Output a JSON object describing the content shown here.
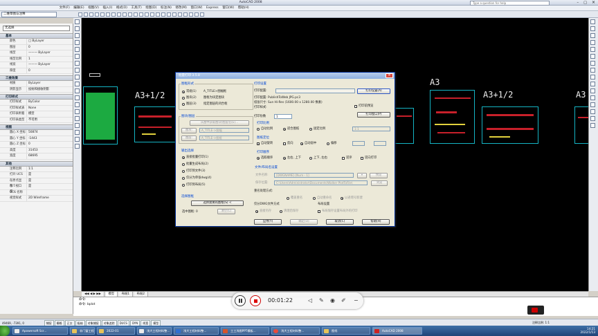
{
  "window": {
    "title": "AutoCAD 2008"
  },
  "help_placeholder": "Type a question for help",
  "menu": [
    "文件(F)",
    "编辑(E)",
    "视图(V)",
    "插入(I)",
    "格式(O)",
    "工具(T)",
    "绘图(D)",
    "标注(N)",
    "修改(M)",
    "窗口(W)",
    "Express",
    "窗口(W)",
    "帮助(H)"
  ],
  "workspace": "二维草图与注释",
  "properties": {
    "combo": "无选择",
    "sections": [
      {
        "title": "基本",
        "rows": [
          [
            "颜色",
            "□ ByLayer"
          ],
          [
            "图层",
            "0"
          ],
          [
            "线型",
            "——— ByLayer"
          ],
          [
            "线型比例",
            "1"
          ],
          [
            "线宽",
            "——— ByLayer"
          ],
          [
            "厚度",
            "0"
          ]
        ]
      },
      {
        "title": "三维效果",
        "rows": [
          [
            "材质",
            "ByLayer"
          ],
          [
            "阴影显示",
            "投射和接收阴影"
          ]
        ]
      },
      {
        "title": "打印样式",
        "rows": [
          [
            "打印样式",
            "ByColor"
          ],
          [
            "打印样式表",
            "None"
          ],
          [
            "打印表附着",
            "模型"
          ],
          [
            "打印表类型",
            "不可用"
          ]
        ]
      },
      {
        "title": "视图",
        "rows": [
          [
            "圆心 X 坐标",
            "50874"
          ],
          [
            "圆心 Y 坐标",
            "-1443"
          ],
          [
            "圆心 Z 坐标",
            "0"
          ],
          [
            "高度",
            "31453"
          ],
          [
            "宽度",
            "68695"
          ]
        ]
      },
      {
        "title": "其他",
        "rows": [
          [
            "注释比例",
            "1:1"
          ],
          [
            "打开 UCS ...",
            "是"
          ],
          [
            "在原点显示...",
            "是"
          ],
          [
            "每个视口都...",
            "是"
          ],
          [
            "UCS 名称",
            ""
          ],
          [
            "视觉样式",
            "2D Wireframe"
          ]
        ]
      }
    ]
  },
  "drawing_labels": [
    "A3+1/2",
    "A3",
    "A3+1/2",
    "A3"
  ],
  "layout_tabs": [
    "模型",
    "布局1",
    "布局2"
  ],
  "command_lines": [
    "命令:",
    "命令: bplot"
  ],
  "player": {
    "time": "00:01:22"
  },
  "status": {
    "coords": "49469, -7391, 0",
    "toggles": [
      "捕捉",
      "栅格",
      "正交",
      "极轴",
      "对象捕捉",
      "对象追踪",
      "DUCS",
      "DYN",
      "线宽",
      "模型"
    ],
    "scale": "注释比例: 1:1"
  },
  "taskbar": {
    "items": [
      "Apowersoft Scr...",
      "非门窗工程",
      "2022-01",
      "浅大工程材料整...",
      "工工浅图PPT模板...",
      "浅大工程材料整...",
      "图纸",
      "AutoCAD 2008"
    ],
    "clock_time": "14:21",
    "clock_date": "2022/1/13"
  },
  "dialog": {
    "title": "批量打印 3.5.8",
    "left": {
      "figure_mode_title": "图框形式",
      "figure_modes": [
        "常规(1)",
        "图块(2)",
        "图层(3)"
      ],
      "figure_mode_descs": [
        "A_TITLE>图幅框",
        "图框为块定图块",
        "指定图层的闭合框"
      ],
      "figure_name_title": "图块/图层",
      "figure_name_btn": "从图中获取图块/图层名(E)...",
      "block_label": "图块:",
      "block_value": "A_TITLE->图幅",
      "layer_label": "图层:",
      "layer_value": "A_TITLE->图框",
      "output_title": "输出选择",
      "outputs": [
        "直接批量打印(1)",
        "批量生成布局(2)",
        "打印到文件(3)",
        "仅分为单张dwg(4)",
        "打印到布局(5)"
      ],
      "select_title": "选择图框",
      "select_btn": "选择需要的图框(S) <",
      "selected_label": "选中图框: 0",
      "clear_btn": "清空(C)"
    },
    "right": {
      "print_title": "打印设置",
      "printer_label": "打印配置:",
      "printer_value": "",
      "printer_btn": "打印设置(A)",
      "info_lines": [
        "打印配置: PublishToWeb JPG.pc3",
        "纸张尺寸: Sun Hi-Res (1600.00 x 1280.00 像素)",
        "打印样式:"
      ],
      "prefix_label": "打印份数",
      "copies_value": "1",
      "fit_title": "打印比例",
      "scale_opts": [
        "自动比例",
        "适合图纸",
        "固定比例"
      ],
      "scale_value": "1:1",
      "rotate_chk": "打印前预览",
      "copy_btn": "打印窗口(P)",
      "dir_title": "图纸定位",
      "dir_opts": [
        "自动旋转",
        "反向",
        "自动居中",
        "偏移"
      ],
      "order_title": "打印顺序",
      "order_opts": [
        "选取顺序",
        "左右, 上下",
        "上下, 左右",
        "逆序",
        "逆向打印"
      ],
      "file_title": "文件/布局名设置",
      "file_name_label": "文件名称:",
      "file_name_value": "[DWGNAME]-[Num - 1]",
      "file_name_btn": "预览",
      "path_label": "保存位置:",
      "path_value": "C:\\Users\\Administrator\\Documents\\Walker PlotToFile\\",
      "path_btn": "浏览",
      "dup_title": "重名处理方式:",
      "dup_opts": [
        "覆盖重名",
        "自动重命名",
        "以递增号新建"
      ],
      "layout_title": "布局设置",
      "sep_title": "仅分DWG文件方式",
      "sep_opts": [
        "直接另存",
        "清理后保存"
      ],
      "layout_chk": "布局保存设置布局外的打印",
      "buttons": [
        "应用(Y)",
        "确定(O)",
        "取消(C)",
        "帮助(H)"
      ]
    }
  }
}
